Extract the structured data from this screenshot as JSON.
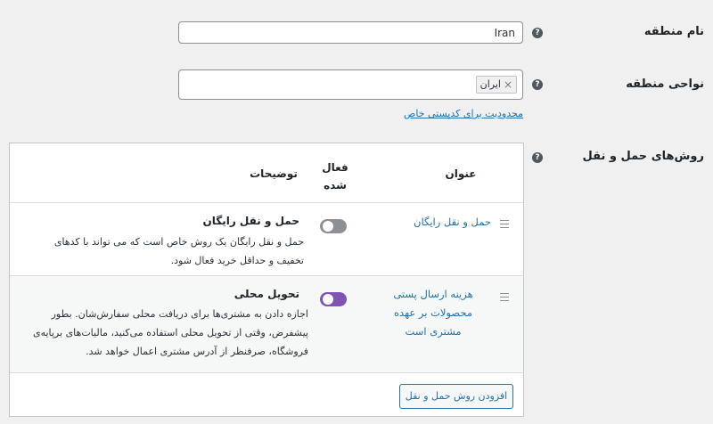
{
  "zone_name": {
    "label": "نام منطقه",
    "value": "Iran"
  },
  "zone_regions": {
    "label": "نواحی منطقه",
    "chip": "ایران",
    "chip_remove": "×",
    "postcode_link": "محدودیت برای کدپستی خاص"
  },
  "help_glyph": "?",
  "shipping_methods": {
    "label": "روش‌های حمل و نقل",
    "columns": {
      "title": "عنوان",
      "enabled": "فعال شده",
      "description": "توضیحات"
    },
    "rows": [
      {
        "title": "حمل و نقل رایگان",
        "enabled": false,
        "desc_title": "حمل و نقل رایگان",
        "desc_text": "حمل و نقل رایگان یک روش خاص است که می تواند با کدهای تخفیف و حداقل خرید فعال شود."
      },
      {
        "title": "هزینه ارسال پستی محصولات بر عهده مشتری است",
        "enabled": true,
        "desc_title": "تحویل محلی",
        "desc_text": "اجازه دادن به مشتری‌ها برای دریافت محلی سفارش‌شان. بطور پیشفرض، وقتی از تحویل محلی استفاده می‌کنید، مالیات‌های برپایه‌ی فروشگاه، صرفنظر از آدرس مشتری اعمال خواهد شد."
      }
    ],
    "add_button": "افزودن روش حمل و نقل"
  },
  "colors": {
    "toggle_on": "#7f54b3",
    "toggle_off": "#8c8f94",
    "link": "#2271b1"
  }
}
